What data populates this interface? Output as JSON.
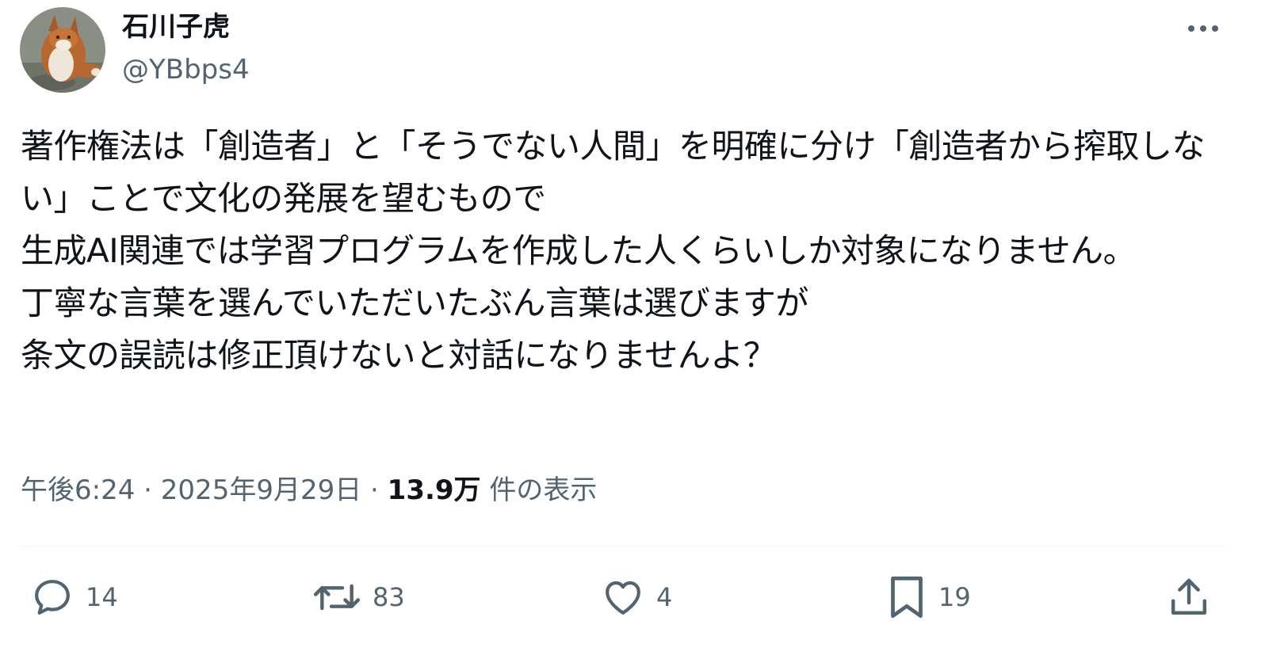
{
  "author": {
    "display_name": "石川子虎",
    "handle": "@YBbps4",
    "avatar_icon": "fox-avatar-icon"
  },
  "tweet": {
    "text": "著作権法は「創造者」と「そうでない人間」を明確に分け「創造者から搾取しない」ことで文化の発展を望むもので\n生成AI関連では学習プログラムを作成した人くらいしか対象になりません。\n丁寧な言葉を選んでいただいたぶん言葉は選びますが\n条文の誤読は修正頂けないと対話になりませんよ？",
    "time": "午後6:24",
    "date": "2025年9月29日",
    "separator": "·",
    "views_count": "13.9万",
    "views_label": "件の表示"
  },
  "actions": {
    "reply": {
      "icon": "reply-icon",
      "count": "14"
    },
    "repost": {
      "icon": "repost-icon",
      "count": "83"
    },
    "like": {
      "icon": "heart-icon",
      "count": "4"
    },
    "bookmark": {
      "icon": "bookmark-icon",
      "count": "19"
    },
    "share": {
      "icon": "share-icon"
    }
  },
  "colors": {
    "text_primary": "#0f1419",
    "text_secondary": "#536471",
    "divider": "#eff3f4"
  }
}
